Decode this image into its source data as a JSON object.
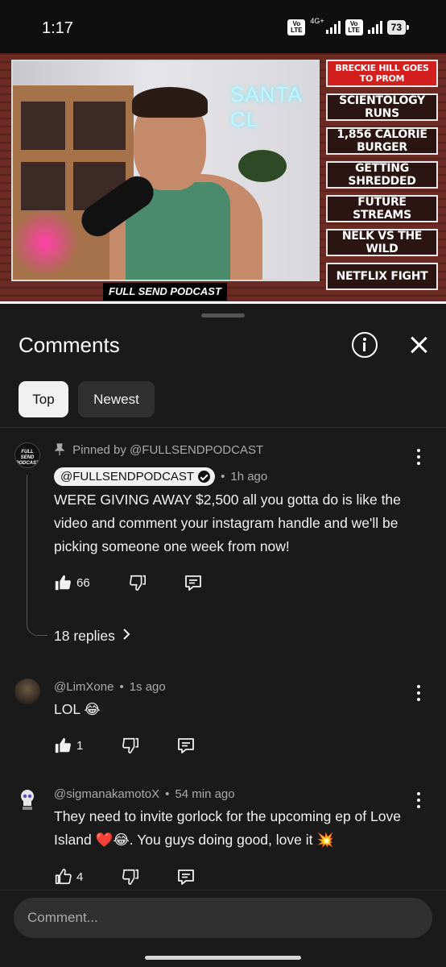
{
  "status_bar": {
    "time": "1:17",
    "volte1": "Vo LTE",
    "network": "4G+",
    "volte2": "Vo LTE",
    "battery": "73"
  },
  "video": {
    "neon_sign": "SANTA CL",
    "caption": "FULL SEND PODCAST",
    "topics": [
      {
        "label": "BRECKIE HILL GOES TO PROM",
        "active": true
      },
      {
        "label": "SCIENTOLOGY RUNS",
        "active": false
      },
      {
        "label": "1,856 CALORIE BURGER",
        "active": false
      },
      {
        "label": "GETTING SHREDDED",
        "active": false
      },
      {
        "label": "FUTURE STREAMS",
        "active": false
      },
      {
        "label": "NELK VS THE WILD",
        "active": false
      },
      {
        "label": "NETFLIX FIGHT",
        "active": false
      }
    ]
  },
  "panel": {
    "title": "Comments",
    "info_icon": "info-icon",
    "close_icon": "close-icon",
    "filters": {
      "top": "Top",
      "newest": "Newest"
    }
  },
  "comments": [
    {
      "pinned_label": "Pinned by @FULLSENDPODCAST",
      "author": "@FULLSENDPODCAST",
      "avatar_text": "FULL SEND PODCAST",
      "time": "1h ago",
      "text": "WERE GIVING AWAY $2,500 all you gotta do is like the video and comment your instagram handle and we'll be picking someone one week from now!",
      "likes": "66",
      "replies": "18 replies"
    },
    {
      "author": "@LimXone",
      "time": "1s ago",
      "text": "LOL 😂",
      "likes": "1"
    },
    {
      "author": "@sigmanakamotoX",
      "time": "54 min ago",
      "text": "They need to invite gorlock for the upcoming ep of Love Island ❤️😂. You guys doing good, love it 💥",
      "likes": "4"
    }
  ],
  "composer": {
    "placeholder": "Comment..."
  },
  "colors": {
    "background": "#0f0f0f",
    "panel": "#1a1a1a",
    "chip_active": "#f1f1f1",
    "topic_active": "#d41f1f"
  }
}
